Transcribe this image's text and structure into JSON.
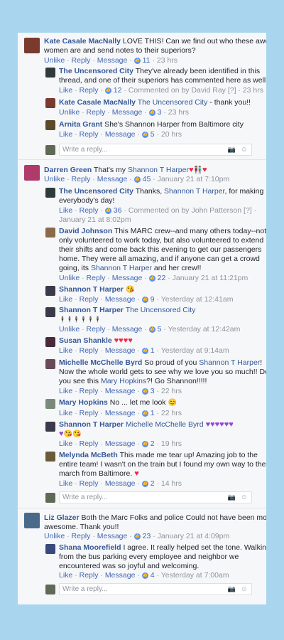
{
  "ui": {
    "like": "Like",
    "unlike": "Unlike",
    "reply": "Reply",
    "message": "Message",
    "dot": "·",
    "write_reply": "Write a reply...",
    "like_glyph": "👍",
    "heart": "♥",
    "purple_heart": "♥",
    "kiss": "😘",
    "blush": "😊",
    "camera": "📷",
    "smiley": "☺"
  },
  "thread1": {
    "c1": {
      "name": "Kate Casale MacNally",
      "text1": "LOVE THIS! Can we find out who these awesome",
      "text2": "women are and send notes to their superiors?",
      "count": "11",
      "time": "23 hrs"
    },
    "r1": {
      "name": "The Uncensored City",
      "text1": "They've already been identified in this",
      "text2": "thread, and one of their superiors has commented here as well!",
      "count": "12",
      "time": "Commented on by David Ray [?] · 23 hrs"
    },
    "r2": {
      "name": "Kate Casale MacNally",
      "mention": "The Uncensored City",
      "text": "- thank you!!",
      "count": "3",
      "time": "23 hrs"
    },
    "r3": {
      "name": "Arnita Grant",
      "text": "She's Shannon Harper from Baltimore city",
      "count": "5",
      "time": "20 hrs"
    }
  },
  "thread2": {
    "c1": {
      "name": "Darren Green",
      "text": "That's my",
      "mention": "Shannon T Harper",
      "count": "45",
      "time": "January 21 at 7:10pm"
    },
    "r1": {
      "name": "The Uncensored City",
      "text1a": "Thanks,",
      "mention": "Shannon T Harper",
      "text1b": ", for making",
      "text2": "everybody's day!",
      "count": "36",
      "time1": "Commented on by John Patterson [?] ·",
      "time2": "January 21 at 8:02pm"
    },
    "r2": {
      "name": "David Johnson",
      "text1": "This MARC crew--and many others today--not",
      "text2": "only volunteered to work today, but also volunteered to extend",
      "text3": "their shifts and come back this evening to get our passengers",
      "text4": "home. They were all amazing, and if anyone can get a crowd",
      "text5a": "going, its",
      "mention": "Shannon T Harper",
      "text5b": "and her crew!!",
      "count": "22",
      "time": "January 21 at 11:21pm"
    },
    "r3": {
      "name": "Shannon T Harper",
      "count": "9",
      "time": "Yesterday at 12:41am"
    },
    "r4": {
      "name": "Shannon T Harper",
      "mention": "The Uncensored City",
      "text": "🕴🕴🕴🕴🕴🕴",
      "count": "5",
      "time": "Yesterday at 12:42am"
    },
    "r5": {
      "name": "Susan Shankle",
      "count": "1",
      "time": "Yesterday at 9:14am"
    },
    "r6": {
      "name": "Michelle McChelle Byrd",
      "text1a": "So proud of you",
      "mention1": "Shannon T Harper",
      "text1b": "!",
      "text2": "Now the whole world gets to see why we love you so much!! Do",
      "text3a": "you see this",
      "mention2": "Mary Hopkins",
      "text3b": "?! Go Shannon!!!!!",
      "count": "3",
      "time": "22 hrs"
    },
    "r7": {
      "name": "Mary Hopkins",
      "text": "No ... let me look",
      "count": "1",
      "time": "22 hrs"
    },
    "r8": {
      "name": "Shannon T Harper",
      "mention": "Michelle McChelle Byrd",
      "count": "2",
      "time": "19 hrs"
    },
    "r9": {
      "name": "Melynda McBeth",
      "text1": "This made me tear up! Amazing job to the",
      "text2": "entire team! I wasn't on the train but I found my own way to the",
      "text3": "march from Baltimore.",
      "count": "2",
      "time": "14 hrs"
    }
  },
  "thread3": {
    "c1": {
      "name": "Liz Glazer",
      "text1": "Both the Marc Folks and police Could not have been more",
      "text2": "awesome. Thank you!!",
      "count": "23",
      "time": "January 21 at 4:09pm"
    },
    "r1": {
      "name": "Shana Moorefield",
      "text1": "I agree. It really helped set the tone. Walking in",
      "text2": "from the bus parking every employee and neighbor we",
      "text3": "encountered was so joyful and welcoming.",
      "count": "4",
      "time": "Yesterday at 7:00am"
    }
  }
}
